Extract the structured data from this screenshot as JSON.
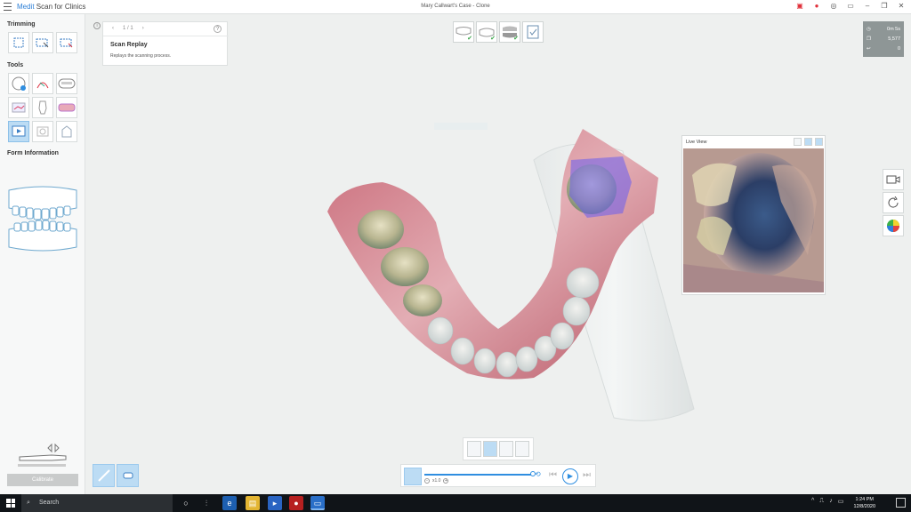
{
  "titlebar": {
    "brand_left": "Medit",
    "brand_right": "Scan for Clinics",
    "case_title": "Mary Callwart's Case - Clone",
    "icons": [
      "record-icon",
      "stop-record-icon",
      "screenshot-icon",
      "tablet-mode-icon",
      "minimize-icon",
      "restore-icon",
      "close-icon"
    ]
  },
  "sidebar": {
    "trimming_title": "Trimming",
    "tools_title": "Tools",
    "form_title": "Form Information",
    "calibrate_label": "Calibrate",
    "trimming_tools": [
      "trim-select-icon",
      "trim-area-icon",
      "trim-lock-icon"
    ],
    "tools": [
      "scan-brush-icon",
      "margin-icon",
      "smart-scan-icon",
      "compare-icon",
      "bite-icon",
      "arch-icon",
      "replay-icon",
      "screen-icon",
      "measure-icon"
    ]
  },
  "info_card": {
    "page": "1 / 1",
    "title": "Scan Replay",
    "subtitle": "Replays the scanning process.",
    "help": "?"
  },
  "info_icon": "i",
  "stages": [
    "maxilla-stage",
    "mandible-stage",
    "occlusion-stage",
    "complete-stage"
  ],
  "stats": {
    "time": "0m 5s",
    "count": "5,577",
    "missing": "0"
  },
  "live_view": {
    "title": "Live View"
  },
  "right_tools": [
    "camera-icon",
    "rotate-icon",
    "color-map-icon"
  ],
  "player": {
    "speed": "x1.0",
    "progress": 0.86
  },
  "taskbar": {
    "search_placeholder": "Search",
    "time": "1:24 PM",
    "date": "12/8/2020"
  },
  "colors": {
    "accent": "#2f8ee0",
    "active_tool": "#bcdcf4",
    "gum": "#d99aa2",
    "scan_blue": "#6a5cf0"
  }
}
